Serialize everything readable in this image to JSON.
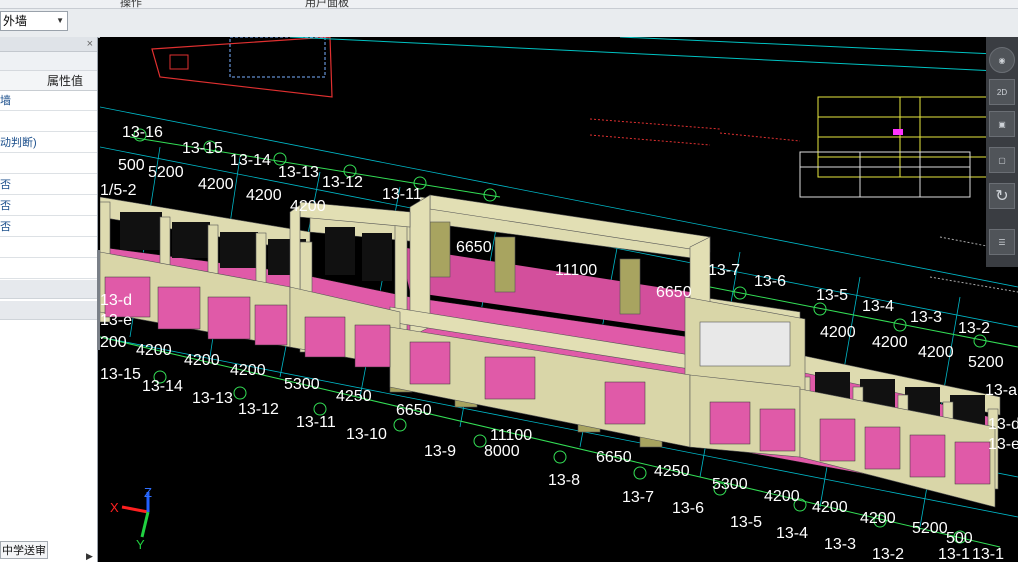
{
  "menu": {
    "items": [
      "操作",
      "用户面板"
    ]
  },
  "toolbar": {
    "floor_selector": "外墙"
  },
  "properties_panel": {
    "header": "属性值",
    "rows": [
      "墙",
      "",
      "动判断)",
      "",
      "否",
      "否",
      "否",
      "",
      ""
    ],
    "bottom_tab": "中学送审"
  },
  "viewport": {
    "axis_labels_back": [
      "13-16",
      "13-15",
      "13-14",
      "13-13",
      "13-12",
      "13-11"
    ],
    "axis_labels_front": [
      "13-15",
      "13-14",
      "13-13",
      "13-12",
      "13-11",
      "13-10",
      "13-9",
      "13-8",
      "13-7",
      "13-6",
      "13-5",
      "13-4",
      "13-3",
      "13-2",
      "13-1"
    ],
    "axis_labels_right": [
      "13-7",
      "13-6",
      "13-5",
      "13-4",
      "13-3",
      "13-2",
      "13-a",
      "13-d",
      "13-e",
      "13-1"
    ],
    "side_labels": [
      "1/5-2",
      "13-d",
      "13-e"
    ],
    "dims_back": [
      "500",
      "5200",
      "4200",
      "4200",
      "4200",
      "6650",
      "11100",
      "6650"
    ],
    "dims_front": [
      "200",
      "4200",
      "4200",
      "4200",
      "5300",
      "4250",
      "6650",
      "11100",
      "8000",
      "6650",
      "4250",
      "5300",
      "4200",
      "4200",
      "4200",
      "5200",
      "500"
    ],
    "dims_right": [
      "4200",
      "4200",
      "4200",
      "5200"
    ],
    "axes": {
      "x": "X",
      "z": "Z",
      "y": "Y"
    },
    "colors": {
      "wall": "#d9d6a8",
      "floor": "#e05aa8",
      "grid": "#00c2c2",
      "dim": "#33dd55"
    }
  },
  "view_tools": [
    "sphere-view-icon",
    "2d-view-icon",
    "3d-box-icon",
    "cube-view-icon",
    "rotate-icon",
    "layers-icon"
  ],
  "view_tool_labels": {
    "2d": "2D"
  }
}
